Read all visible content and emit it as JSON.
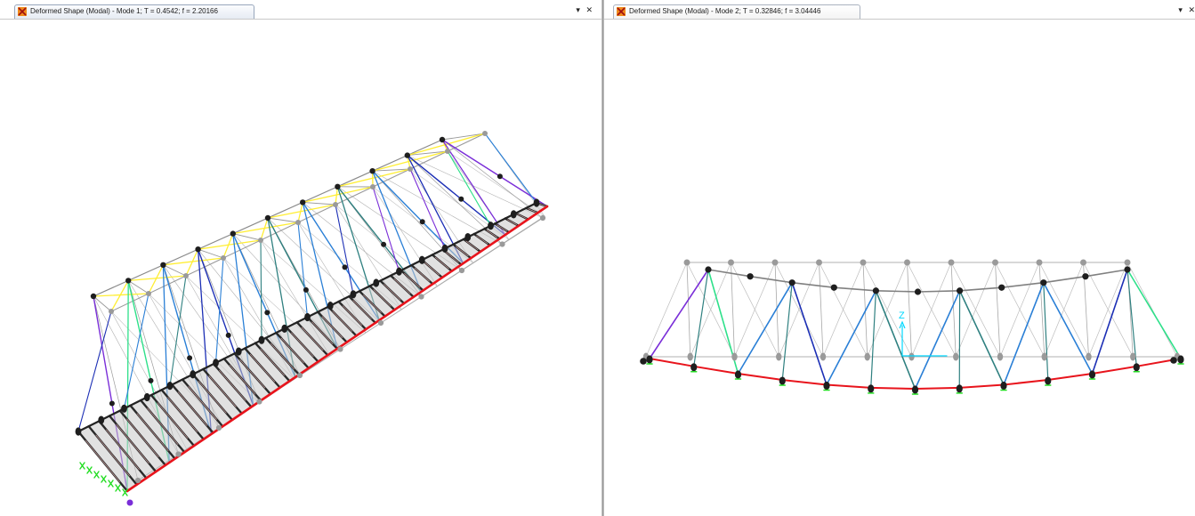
{
  "left_window": {
    "title": "Deformed Shape (Modal) - Mode 1; T = 0.4542;  f = 2.20166",
    "dropdown_glyph": "▾",
    "close_glyph": "✕"
  },
  "right_window": {
    "title": "Deformed Shape (Modal) - Mode 2; T = 0.32846;  f = 3.04446",
    "dropdown_glyph": "▾",
    "close_glyph": "✕",
    "axis_label": "Z"
  },
  "colors": {
    "deck_chord": "#e8141c",
    "top_chord": "#8c8c8c",
    "joint": "#1e1e1e",
    "ghost_joint": "#9a9a9a",
    "member_blue": "#2a7fd6",
    "member_darkblue": "#1c2fb5",
    "member_teal": "#2f8080",
    "member_green": "#2ee08a",
    "member_purple": "#7a2ed8",
    "bracing_yellow": "#ffee33",
    "axis_cyan": "#00d8ff",
    "support_green": "#22dd22"
  }
}
